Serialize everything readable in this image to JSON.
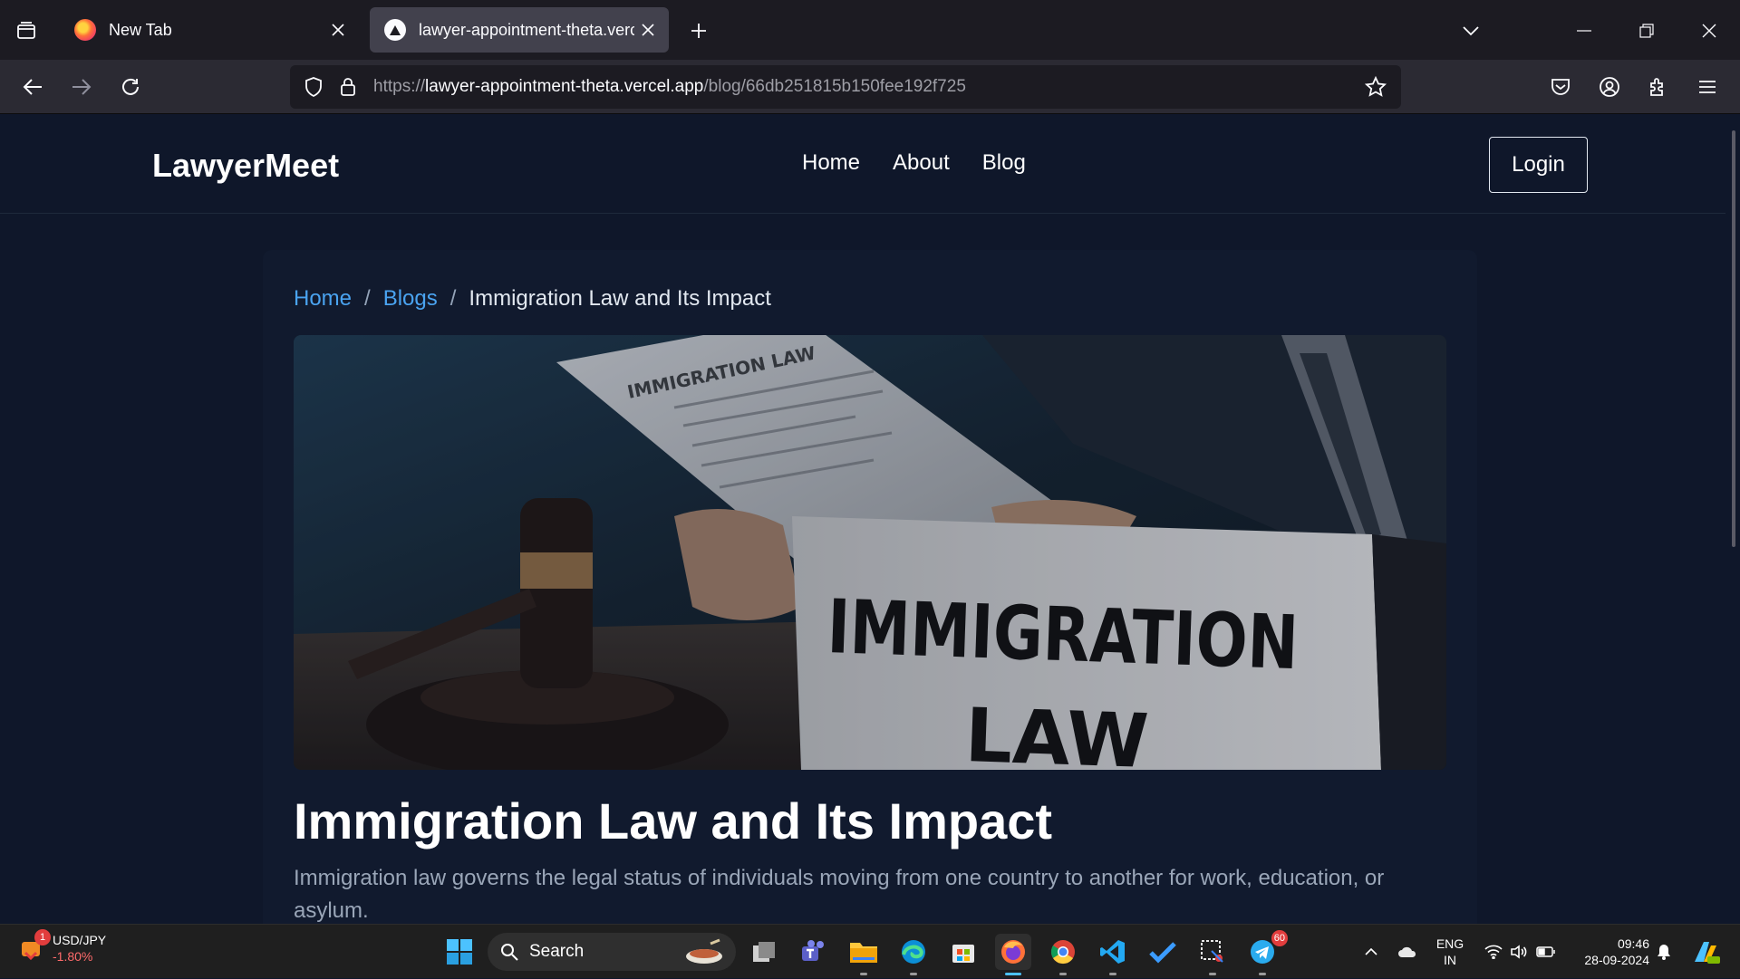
{
  "browser": {
    "tabs": [
      {
        "title": "New Tab",
        "icon": "firefox-icon"
      },
      {
        "title": "lawyer-appointment-theta.vercel.app",
        "icon": "vercel-icon"
      }
    ],
    "url": {
      "scheme": "https://",
      "host": "lawyer-appointment-theta.vercel.app",
      "path": "/blog/66db251815b150fee192f725"
    }
  },
  "site": {
    "logo": "LawyerMeet",
    "nav": {
      "home": "Home",
      "about": "About",
      "blog": "Blog"
    },
    "login": "Login"
  },
  "breadcrumb": {
    "home": "Home",
    "sep1": "/",
    "blogs": "Blogs",
    "sep2": "/",
    "current": "Immigration Law and Its Impact"
  },
  "hero_image": {
    "alt": "Immigration Law",
    "sign_line1": "IMMIGRATION",
    "sign_line2": "LAW",
    "paper_heading": "IMMIGRATION LAW"
  },
  "post": {
    "title": "Immigration Law and Its Impact",
    "description": "Immigration law governs the legal status of individuals moving from one country to another for work, education, or asylum."
  },
  "taskbar": {
    "widget": {
      "badge": "1",
      "pair": "USD/JPY",
      "change": "-1.80%"
    },
    "search_label": "Search",
    "telegram_badge": "60",
    "lang": {
      "line1": "ENG",
      "line2": "IN"
    },
    "clock": {
      "time": "09:46",
      "date": "28-09-2024"
    }
  },
  "colors": {
    "page_bg": "#0f172a",
    "link": "#4aa3f0",
    "card_bg": "#111a2e"
  }
}
